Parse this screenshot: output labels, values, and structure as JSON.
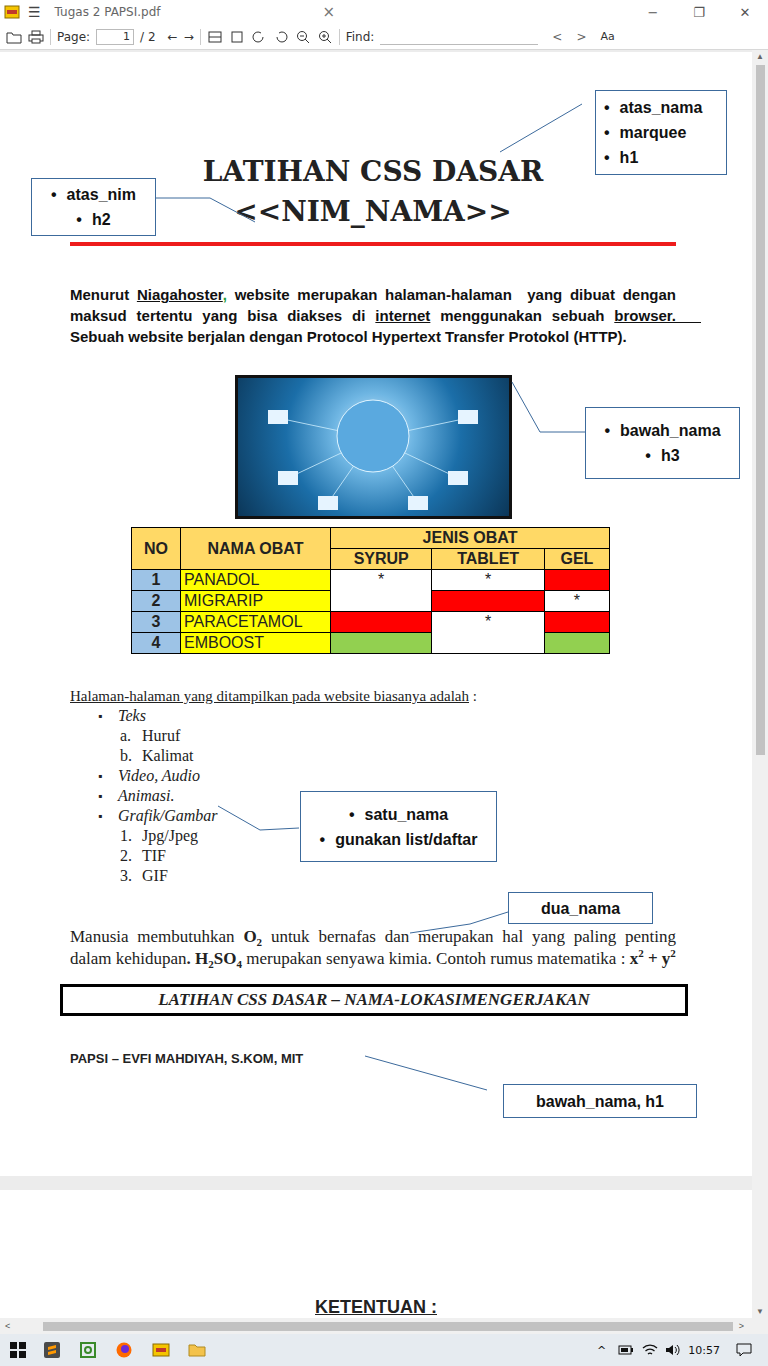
{
  "window": {
    "title": "Tugas 2 PAPSI.pdf",
    "menu": "☰",
    "close_tab": "×",
    "controls": [
      "−",
      "❐",
      "✕"
    ]
  },
  "toolbar": {
    "page_label": "Page:",
    "page_value": "1",
    "page_total": "/ 2",
    "prev": "←",
    "next": "→",
    "find_label": "Find:",
    "find_value": "",
    "find_prev": "<",
    "find_next": ">",
    "case": "Aa"
  },
  "document": {
    "title": "LATIHAN CSS DASAR",
    "subtitle": "<<NIM_NAMA>>",
    "paragraph": [
      {
        "text": "Menurut ",
        "kind": "plain"
      },
      {
        "text": "Niagahoster",
        "kind": "underline"
      },
      {
        "text": ",",
        "kind": "green"
      },
      {
        "text": " website merupakan halaman-halaman  yang dibuat dengan maksud tertentu yang bisa diakses di ",
        "kind": "plain"
      },
      {
        "text": "internet",
        "kind": "underline"
      },
      {
        "text": " menggunakan sebuah ",
        "kind": "plain"
      },
      {
        "text": "browser.      ",
        "kind": "underline"
      },
      {
        "text": "Sebuah website berjalan dengan Protocol Hypertext Transfer Protokol (HTTP).",
        "kind": "plain"
      }
    ],
    "table": {
      "header": [
        "NO",
        "NAMA OBAT",
        "JENIS OBAT"
      ],
      "subheader": [
        "SYRUP",
        "TABLET",
        "GEL"
      ],
      "rows": [
        {
          "no": "1",
          "name": "PANADOL",
          "cells": [
            {
              "text": "*",
              "color": "#ffffff",
              "rowspan": 2
            },
            {
              "text": "*",
              "color": "#ffffff",
              "rowspan": 1
            },
            {
              "text": "",
              "color": "#ff0000",
              "rowspan": 1
            }
          ]
        },
        {
          "no": "2",
          "name": "MIGRARIP",
          "cells": [
            {
              "text": "",
              "color": "#ff0000",
              "rowspan": 1
            },
            {
              "text": "*",
              "color": "#ffffff",
              "rowspan": 1
            }
          ]
        },
        {
          "no": "3",
          "name": "PARACETAMOL",
          "cells": [
            {
              "text": "",
              "color": "#ff0000",
              "rowspan": 1
            },
            {
              "text": "*",
              "color": "#ffffff",
              "rowspan": 2
            },
            {
              "text": "",
              "color": "#ff0000",
              "rowspan": 1
            }
          ]
        },
        {
          "no": "4",
          "name": "EMBOOST",
          "cells": [
            {
              "text": "",
              "color": "#92d050",
              "rowspan": 1
            },
            {
              "text": "",
              "color": "#92d050",
              "rowspan": 1
            }
          ]
        }
      ]
    },
    "list": {
      "heading": "Halaman-halaman yang ditampilkan pada website biasanya adalah",
      "heading_tail": " :",
      "bullet": "▪",
      "items": [
        {
          "text": "Teks",
          "sub": [
            {
              "marker": "a.",
              "text": "Huruf"
            },
            {
              "marker": "b.",
              "text": "Kalimat"
            }
          ]
        },
        {
          "text": "Video, Audio",
          "sub": []
        },
        {
          "text": "Animasi.",
          "sub": []
        },
        {
          "text": "Grafik/Gambar",
          "sub": [
            {
              "marker": "1.",
              "text": "Jpg/Jpeg"
            },
            {
              "marker": "2.",
              "text": "TIF"
            },
            {
              "marker": "3.",
              "text": "GIF"
            }
          ]
        }
      ]
    },
    "formula": [
      {
        "text": "Manusia membutuhkan ",
        "kind": "normal"
      },
      {
        "text": "O",
        "kind": "bold"
      },
      {
        "text": "2",
        "kind": "bold-sub"
      },
      {
        "text": " untuk bernafas dan merupakan hal yang paling penting dalam kehidupan",
        "kind": "normal"
      },
      {
        "text": ".",
        "kind": "bold"
      },
      {
        "text": " ",
        "kind": "normal"
      },
      {
        "text": "H",
        "kind": "bold"
      },
      {
        "text": "2",
        "kind": "bold-sub"
      },
      {
        "text": "SO",
        "kind": "bold"
      },
      {
        "text": "4",
        "kind": "bold-sub"
      },
      {
        "text": " merupakan senyawa kimia. Contoh rumus matematika : ",
        "kind": "normal"
      },
      {
        "text": "x",
        "kind": "bold"
      },
      {
        "text": "2",
        "kind": "bold-sup"
      },
      {
        "text": " + y",
        "kind": "bold"
      },
      {
        "text": "2",
        "kind": "bold-sup"
      }
    ],
    "box": "LATIHAN CSS DASAR – NAMA-LOKASIMENGERJAKAN",
    "footer": "PAPSI – EVFI MAHDIYAH, S.KOM, MIT",
    "callouts": [
      {
        "kind": "list",
        "bullet": "•",
        "items": [
          "atas_nama",
          "marquee",
          "h1"
        ]
      },
      {
        "kind": "centered",
        "bullet": "•",
        "items": [
          "atas_nim",
          "h2"
        ]
      },
      {
        "kind": "centered",
        "bullet": "•",
        "items": [
          "bawah_nama",
          "h3"
        ]
      },
      {
        "kind": "centered",
        "bullet": "•",
        "items": [
          "satu_nama",
          "gunakan list/daftar"
        ]
      },
      {
        "kind": "plain",
        "bullet": "",
        "items": [
          "dua_nama"
        ]
      },
      {
        "kind": "plain",
        "bullet": "",
        "items": [
          "bawah_nama, h1"
        ]
      }
    ],
    "page2_heading": "KETENTUAN :"
  },
  "scrollbars": {
    "up": "▲",
    "down": "▼",
    "left": "<",
    "right": ">"
  },
  "taskbar": {
    "tray_chevron": "^",
    "time": "10:57"
  }
}
